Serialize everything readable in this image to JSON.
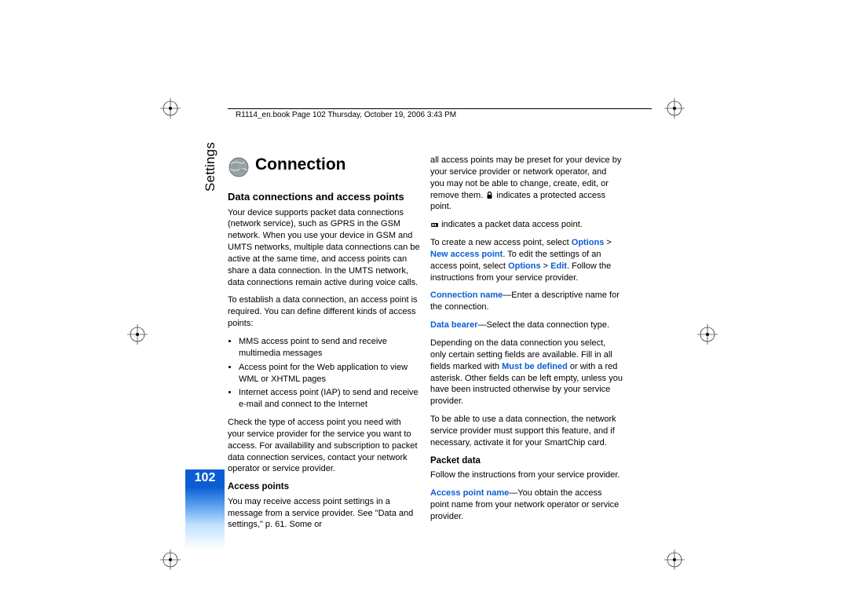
{
  "header": "R1114_en.book  Page 102  Thursday, October 19, 2006  3:43 PM",
  "sidebar_label": "Settings",
  "page_number": "102",
  "title": "Connection",
  "h1": "Data connections and access points",
  "p1": "Your device supports packet data connections (network service), such as GPRS in the GSM network. When you use your device in GSM and UMTS networks, multiple data connections can be active at the same time, and access points can share a data connection. In the UMTS network, data connections remain active during voice calls.",
  "p2": "To establish a data connection, an access point is required. You can define different kinds of access points:",
  "bullets": [
    "MMS access point to send and receive multimedia messages",
    "Access point for the Web application to view WML or XHTML pages",
    "Internet access point (IAP) to send and receive e-mail and connect to the Internet"
  ],
  "p3": "Check the type of access point you need with your service provider for the service you want to access. For availability and subscription to packet data connection services, contact your network operator or service provider.",
  "h2": "Access points",
  "p4": "You may receive access point settings in a message from a service provider. See \"Data and settings,\" p. 61. Some or",
  "r1a": "all access points may be preset for your device by your service provider or network operator, and you may not be able to change, create, edit, or remove them. ",
  "r1b": " indicates a protected access point.",
  "r2": " indicates a packet data access point.",
  "r3a": "To create a new access point, select ",
  "r3_opt1": "Options",
  "r3_gt": " > ",
  "r3_opt2": "New access point",
  "r3b": ". To edit the settings of an access point, select ",
  "r3_opt3": "Options",
  "r3_opt4": "Edit",
  "r3c": ". Follow the instructions from your service provider.",
  "r4_label": "Connection name",
  "r4_text": "—Enter a descriptive name for the connection.",
  "r5_label": "Data bearer",
  "r5_text": "—Select the data connection type.",
  "r6a": "Depending on the data connection you select, only certain setting fields are available. Fill in all fields marked with ",
  "r6_label": "Must be defined",
  "r6b": " or with a red asterisk. Other fields can be left empty, unless you have been instructed otherwise by your service provider.",
  "r7": "To be able to use a data connection, the network service provider must support this feature, and if necessary, activate it for your SmartChip card.",
  "h3": "Packet data",
  "r8": "Follow the instructions from your service provider.",
  "r9_label": "Access point name",
  "r9_text": "—You obtain the access point name from your network operator or service provider."
}
